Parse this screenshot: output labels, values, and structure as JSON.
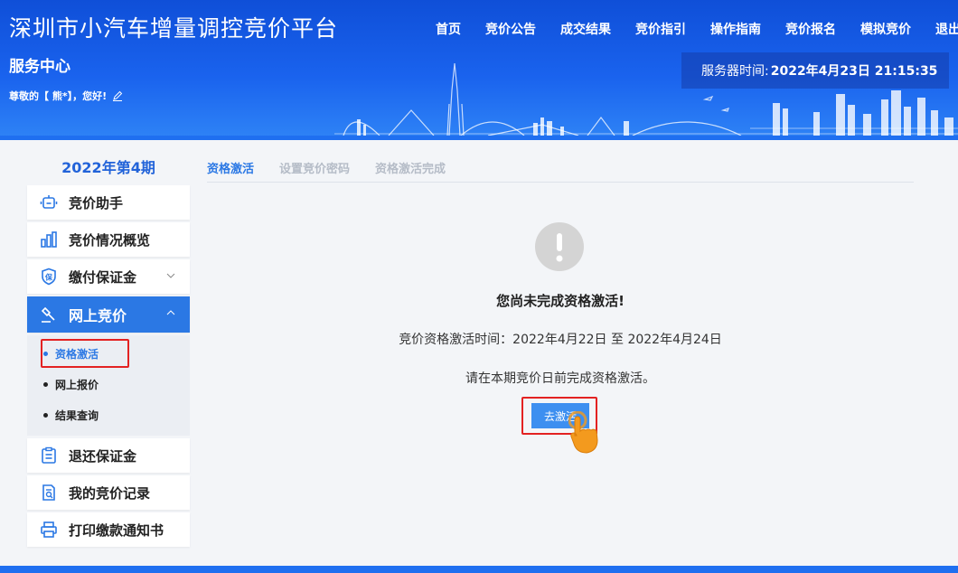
{
  "header": {
    "app_title": "深圳市小汽车增量调控竞价平台",
    "service_center": "服务中心",
    "greeting": "尊敬的【 熊*】，您好!",
    "nav": [
      "首页",
      "竞价公告",
      "成交结果",
      "竞价指引",
      "操作指南",
      "竞价报名",
      "模拟竞价",
      "退出"
    ],
    "server_time_label": "服务器时间:",
    "server_time_value": "2022年4月23日 21:15:35"
  },
  "sidebar": {
    "period": "2022年第4期",
    "items": [
      {
        "label": "竞价助手",
        "icon": "robot-icon"
      },
      {
        "label": "竞价情况概览",
        "icon": "bar-chart-icon"
      },
      {
        "label": "缴付保证金",
        "icon": "shield-bao-icon"
      },
      {
        "label": "网上竞价",
        "icon": "gavel-icon"
      },
      {
        "label": "退还保证金",
        "icon": "clipboard-icon"
      },
      {
        "label": "我的竞价记录",
        "icon": "document-search-icon"
      },
      {
        "label": "打印缴款通知书",
        "icon": "printer-icon"
      }
    ],
    "submenu": [
      "资格激活",
      "网上报价",
      "结果查询"
    ]
  },
  "main": {
    "steps": [
      "资格激活",
      "设置竞价密码",
      "资格激活完成"
    ],
    "warning_title": "您尚未完成资格激活!",
    "activation_time": "竞价资格激活时间：2022年4月22日 至 2022年4月24日",
    "notice": "请在本期竞价日前完成资格激活。",
    "button_label": "去激活"
  },
  "colors": {
    "header_blue": "#1a63ee",
    "accent_blue": "#2b78e4",
    "highlight_red": "#e32222",
    "hand_orange": "#f39a1e"
  }
}
